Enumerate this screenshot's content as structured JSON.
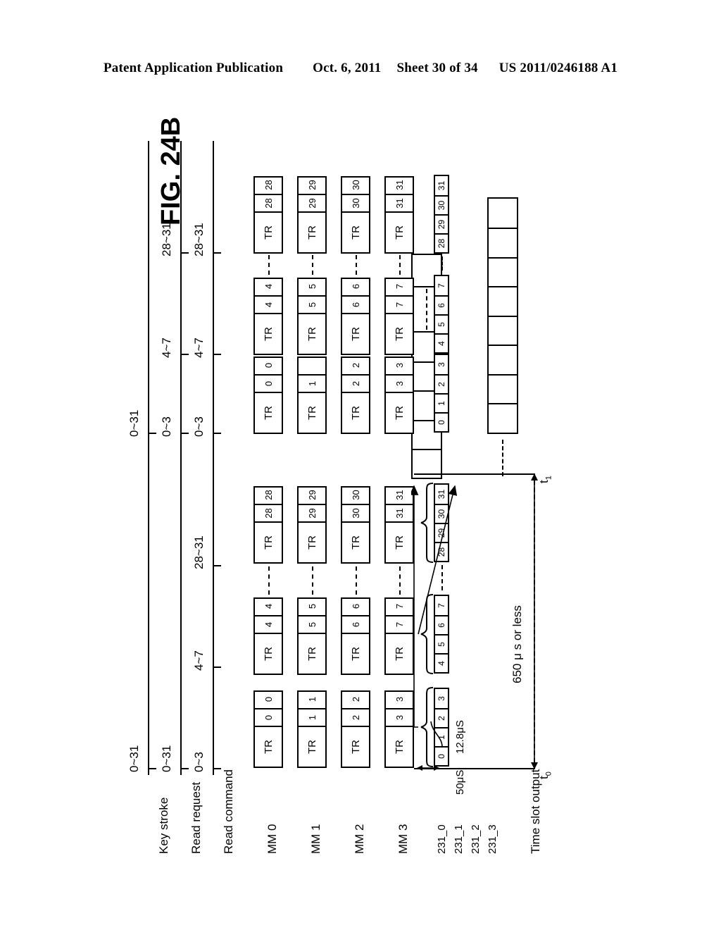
{
  "header": {
    "publication": "Patent Application Publication",
    "date": "Oct. 6, 2011",
    "sheet": "Sheet 30 of 34",
    "docnum": "US 2011/0246188 A1"
  },
  "figure": {
    "title": "FIG. 24B",
    "row_labels": {
      "key_stroke": "Key stroke",
      "read_request": "Read request",
      "read_command": "Read command",
      "mm0": "MM 0",
      "mm1": "MM 1",
      "mm2": "MM 2",
      "mm3": "MM 3",
      "s231_0": "231_0",
      "s231_1": "231_1",
      "s231_2": "231_2",
      "s231_3": "231_3",
      "time_slot_output": "Time slot output"
    },
    "lane_ranges": {
      "key_stroke": [
        "0~31",
        "0~31"
      ],
      "read_request": [
        "0~31",
        "0~3",
        "4~7",
        "28~31"
      ],
      "read_command": [
        "0~3",
        "4~7",
        "28~31",
        "0~3",
        "4~7",
        "28~31"
      ]
    },
    "tr_label": "TR",
    "burst1": {
      "mm0": [
        [
          "0",
          "0"
        ],
        [
          "4",
          "4"
        ],
        [
          "28",
          "28"
        ]
      ],
      "mm1": [
        [
          "1",
          "1"
        ],
        [
          "5",
          "5"
        ],
        [
          "29",
          "29"
        ]
      ],
      "mm2": [
        [
          "2",
          "2"
        ],
        [
          "6",
          "6"
        ],
        [
          "30",
          "30"
        ]
      ],
      "mm3": [
        [
          "3",
          "3"
        ],
        [
          "7",
          "7"
        ],
        [
          "31",
          "31"
        ]
      ]
    },
    "burst2": {
      "mm0": [
        [
          "0",
          "0"
        ],
        [
          "4",
          "4"
        ],
        [
          "28",
          "28"
        ]
      ],
      "mm1": [
        [
          "1",
          ""
        ],
        [
          "5",
          "5"
        ],
        [
          "29",
          "29"
        ]
      ],
      "mm2": [
        [
          "2",
          "2"
        ],
        [
          "6",
          "6"
        ],
        [
          "30",
          "30"
        ]
      ],
      "mm3": [
        [
          "3",
          "3"
        ],
        [
          "7",
          "7"
        ],
        [
          "31",
          "31"
        ]
      ]
    },
    "slot_strips": {
      "burst1": [
        [
          "0",
          "1",
          "2",
          "3"
        ],
        [
          "4",
          "5",
          "6",
          "7"
        ],
        [
          "28",
          "29",
          "30",
          "31"
        ]
      ],
      "burst2": [
        [
          "0",
          "1",
          "2",
          "3"
        ],
        [
          "4",
          "5",
          "6",
          "7"
        ],
        [
          "28",
          "29",
          "30",
          "31"
        ]
      ]
    },
    "time_slot_output": {
      "burst1_left_boxes": 5,
      "burst1_right_boxes": 1,
      "burst2_boxes": 8
    },
    "annotations": {
      "t0": "t",
      "t0_sub": "0",
      "t1": "t",
      "t1_sub": "1",
      "dur_50us": "50μS",
      "dur_128us": "12.8μS",
      "dur_650us": "650 μ s or less"
    }
  }
}
